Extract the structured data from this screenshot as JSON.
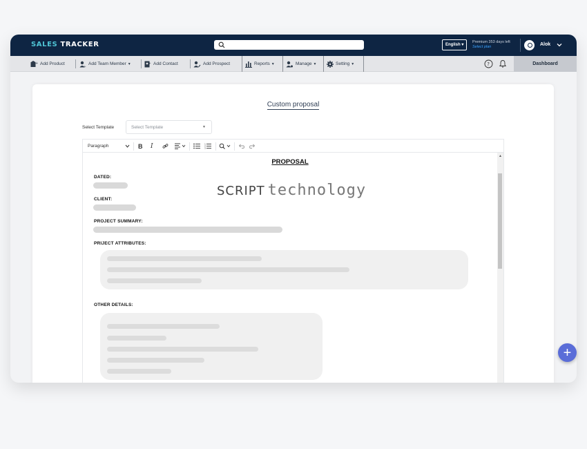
{
  "app": {
    "brand_part1": "SALES ",
    "brand_part2": "TRACKER"
  },
  "topbar": {
    "search_placeholder": "",
    "language": "English",
    "premium_text": "Premium  353 days left",
    "plan_link": "Select plan",
    "user_name": "Alok"
  },
  "menu": {
    "items": [
      {
        "label": "Add Product",
        "icon": "add-product-icon"
      },
      {
        "label": "Add Team Member",
        "icon": "add-team-member-icon",
        "dropdown": true
      },
      {
        "label": "Add Contact",
        "icon": "add-contact-icon"
      },
      {
        "label": "Add Prospect",
        "icon": "add-prospect-icon"
      },
      {
        "label": "Reports",
        "icon": "chart-icon",
        "dropdown": true
      },
      {
        "label": "Manage",
        "icon": "manage-icon",
        "dropdown": true
      },
      {
        "label": "Setting",
        "icon": "gear-icon",
        "dropdown": true
      }
    ],
    "dashboard_label": "Dashboard"
  },
  "page": {
    "title": "Custom proposal",
    "template_label": "Select Template",
    "template_placeholder": "Select Template"
  },
  "editor": {
    "paragraph_style": "Paragraph",
    "doc_title": "PROPOSAL",
    "sections": {
      "dated": "DATED:",
      "client": "CLIENT:",
      "summary": "PROJECT SUMMARY:",
      "attributes": "PRIJECT ATTRIBUTES:",
      "other": "OTHER DETAILS:"
    },
    "logo_word1": "SCRIPT",
    "logo_word2": "technology"
  },
  "colors": {
    "topbar_bg": "#0e2543",
    "brand_accent": "#4fc3d4",
    "fab": "#5a6dd8",
    "plan_link": "#3ba3ff"
  }
}
